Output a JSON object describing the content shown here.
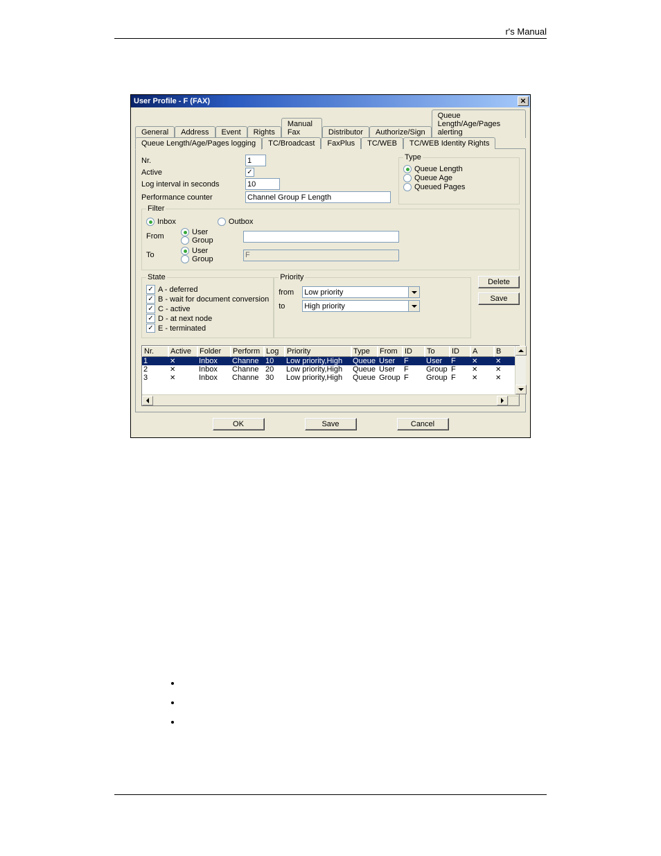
{
  "page_header": "r's Manual",
  "dialog": {
    "title": "User Profile - F (FAX)",
    "tabs_row1": [
      "General",
      "Address",
      "Event",
      "Rights",
      "Manual Fax",
      "Distributor",
      "Authorize/Sign",
      "Queue Length/Age/Pages alerting"
    ],
    "tabs_row2": [
      "Queue Length/Age/Pages logging",
      "TC/Broadcast",
      "FaxPlus",
      "TC/WEB",
      "TC/WEB Identity Rights"
    ],
    "selected_tab": "Queue Length/Age/Pages logging",
    "fields": {
      "nr_label": "Nr.",
      "nr_value": "1",
      "active_label": "Active",
      "active_checked": true,
      "log_interval_label": "Log interval in seconds",
      "log_interval_value": "10",
      "perf_label": "Performance counter",
      "perf_value": "Channel Group F Length"
    },
    "type_group": {
      "legend": "Type",
      "options": [
        {
          "label": "Queue Length",
          "selected": true
        },
        {
          "label": "Queue Age",
          "selected": false
        },
        {
          "label": "Queued Pages",
          "selected": false
        }
      ]
    },
    "filter": {
      "legend": "Filter",
      "inout": [
        {
          "label": "Inbox",
          "selected": true
        },
        {
          "label": "Outbox",
          "selected": false
        }
      ],
      "from_label": "From",
      "to_label": "To",
      "from_kind": [
        {
          "label": "User",
          "selected": true
        },
        {
          "label": "Group",
          "selected": false
        }
      ],
      "to_kind": [
        {
          "label": "User",
          "selected": true
        },
        {
          "label": "Group",
          "selected": false
        }
      ],
      "from_value": "",
      "to_value": "F"
    },
    "state": {
      "legend": "State",
      "items": [
        {
          "label": "A - deferred",
          "checked": true
        },
        {
          "label": "B - wait for document conversion",
          "checked": true
        },
        {
          "label": "C - active",
          "checked": true
        },
        {
          "label": "D - at next node",
          "checked": true
        },
        {
          "label": "E - terminated",
          "checked": true
        }
      ]
    },
    "priority": {
      "legend": "Priority",
      "from_label": "from",
      "to_label": "to",
      "from_value": "Low priority",
      "to_value": "High priority"
    },
    "side_buttons": {
      "delete": "Delete",
      "save": "Save"
    },
    "grid": {
      "headers": [
        "Nr.",
        "Active",
        "Folder",
        "Perform",
        "Log",
        "Priority",
        "Type",
        "From",
        "ID",
        "To",
        "ID",
        "A",
        "B"
      ],
      "rows": [
        {
          "nr": "1",
          "active": "x",
          "folder": "Inbox",
          "perform": "Channe",
          "log": "10",
          "priority": "Low priority,High",
          "type": "Queue",
          "from": "User",
          "id1": "F",
          "to": "User",
          "id2": "F",
          "a": "x",
          "b": "x",
          "selected": true
        },
        {
          "nr": "2",
          "active": "x",
          "folder": "Inbox",
          "perform": "Channe",
          "log": "20",
          "priority": "Low priority,High",
          "type": "Queue",
          "from": "User",
          "id1": "F",
          "to": "Group",
          "id2": "F",
          "a": "x",
          "b": "x",
          "selected": false
        },
        {
          "nr": "3",
          "active": "x",
          "folder": "Inbox",
          "perform": "Channe",
          "log": "30",
          "priority": "Low priority,High",
          "type": "Queue",
          "from": "Group",
          "id1": "F",
          "to": "Group",
          "id2": "F",
          "a": "x",
          "b": "x",
          "selected": false
        }
      ]
    },
    "footer_buttons": {
      "ok": "OK",
      "save": "Save",
      "cancel": "Cancel"
    }
  }
}
